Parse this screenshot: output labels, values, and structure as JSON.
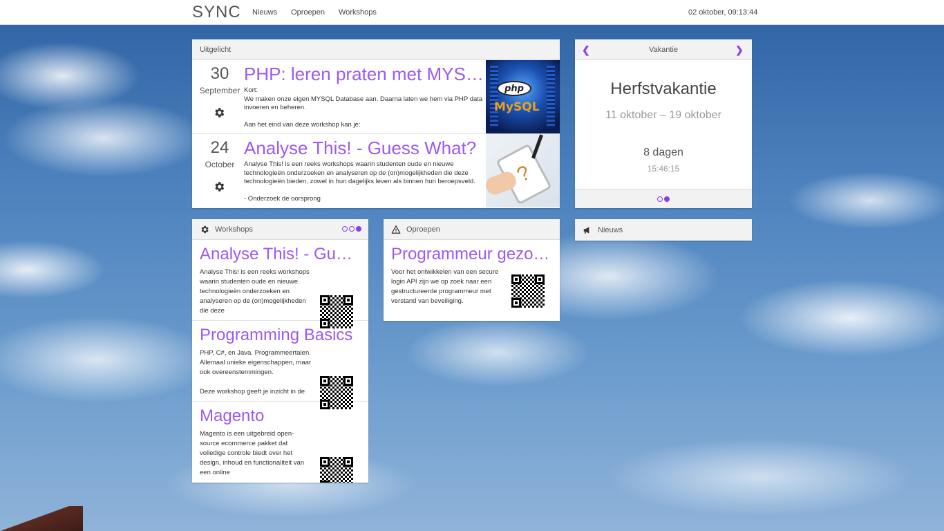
{
  "header": {
    "brand": "SYNC",
    "nav": [
      "Nieuws",
      "Oproepen",
      "Workshops"
    ],
    "clock": "02 oktober, 09:13:44"
  },
  "featured": {
    "title": "Uitgelicht",
    "items": [
      {
        "day": "30",
        "month": "September",
        "title": "PHP: leren praten met MYSQL…",
        "text": "Kort:\nWe maken onze eigen MYSQL Database aan. Daarna laten we hem via PHP data invoeren en beheren.\n\nAan het eind van deze workshop kan je:",
        "image_text": [
          "php",
          "MySQL"
        ]
      },
      {
        "day": "24",
        "month": "October",
        "title": "Analyse This! - Guess What?",
        "text": "Analyse This! is een reeks workshops waarin studenten oude en nieuwe technologieën onderzoeken en analyseren op de (on)mogelijkheden die deze technologieën bieden, zowel in hun dagelijks leven als binnen hun beroepsveld.\n\n- Onderzoek de oorsprong"
      }
    ]
  },
  "vacation": {
    "title": "Vakantie",
    "name": "Herfstvakantie",
    "range": "11 oktober – 19 oktober",
    "days": "8 dagen",
    "time": "15:46:15",
    "dots": 2,
    "active_dot": 1,
    "accent": "#8a3fe6"
  },
  "workshops": {
    "title": "Workshops",
    "dots": 3,
    "active_dot": 2,
    "items": [
      {
        "title": "Analyse This! - Guess What?",
        "text": "Analyse This! is een reeks workshops waarin studenten oude en nieuwe technologieën onderzoeken en analyseren op de (on)mogelijkheden die deze"
      },
      {
        "title": "Programming Basics",
        "text": "PHP, C#, en Java. Programmeertalen. Allemaal unieke eigenschappen, maar ook overeenstemmingen.\n\nDeze workshop geeft je inzicht in de"
      },
      {
        "title": "Magento",
        "text": "Magento is een uitgebreid open-source ecommerce pakket dat volledige controle biedt over het design, inhoud en functionaliteit van een online"
      }
    ]
  },
  "oproepen": {
    "title": "Oproepen",
    "item": {
      "title": "Programmeur gezocht",
      "text": "Voor het ontwikkelen van een secure login API zijn we op zoek naar een gestructureerde programmeur met verstand van beveiliging."
    }
  },
  "nieuws": {
    "title": "Nieuws"
  },
  "colors": {
    "accent_title": "#9b59f5",
    "accent_nav": "#8a3fe6"
  },
  "icons": [
    "gear-icon",
    "warning-icon",
    "megaphone-icon",
    "chevron-left-icon",
    "chevron-right-icon",
    "qr-code-icon"
  ]
}
